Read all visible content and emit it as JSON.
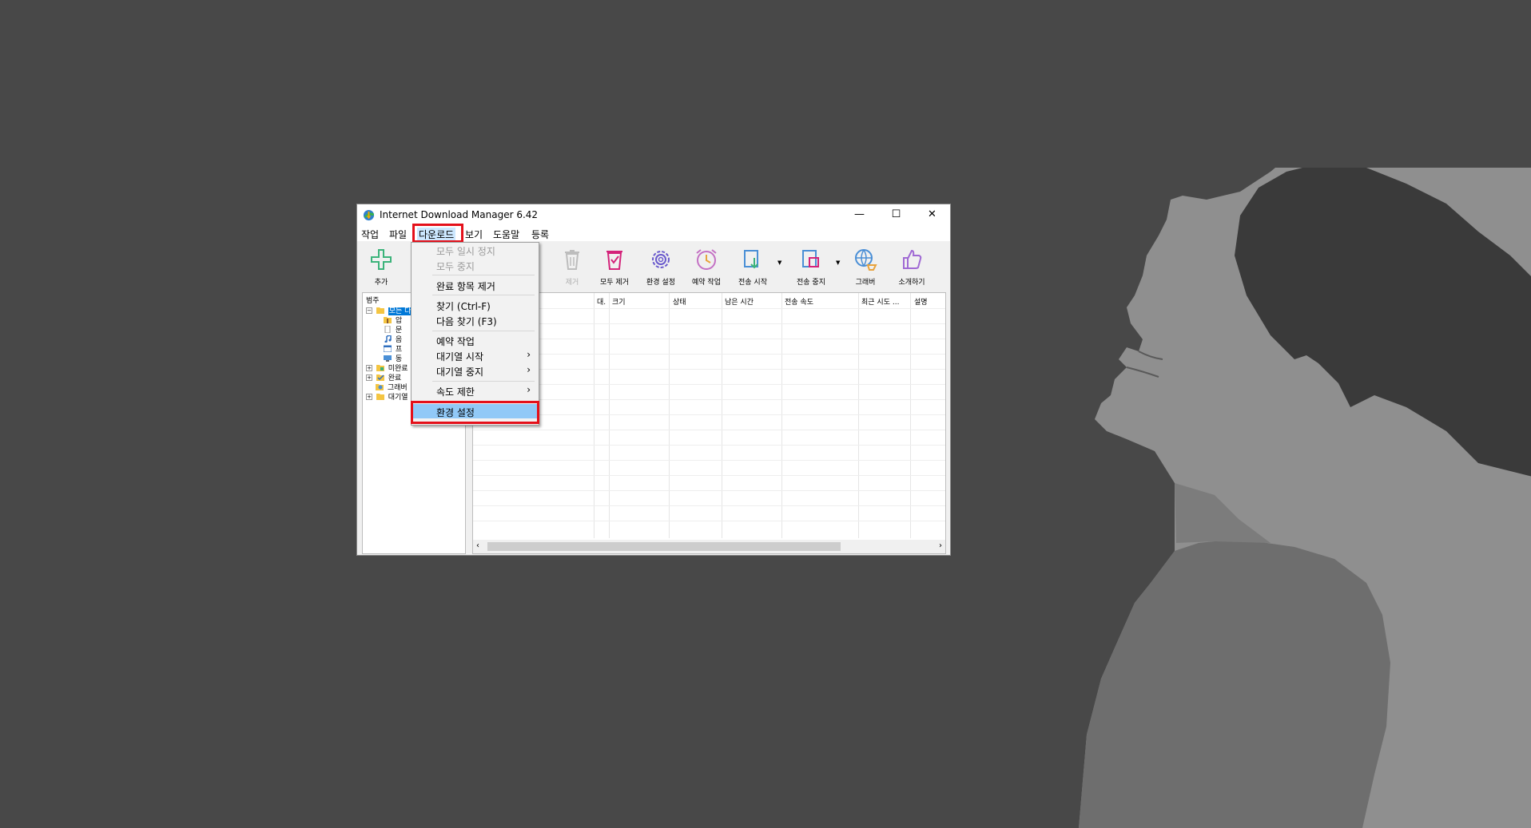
{
  "window": {
    "title": "Internet Download Manager 6.42",
    "controls": {
      "minimize": "—",
      "maximize": "☐",
      "close": "✕"
    }
  },
  "menubar": {
    "items": [
      "작업",
      "파일",
      "다운로드",
      "보기",
      "도움말",
      "등록"
    ],
    "active": "다운로드"
  },
  "toolbar": {
    "add": "추가",
    "remove": "제거",
    "remove_all": "모두 제거",
    "settings": "환경 설정",
    "scheduler": "예약 작업",
    "start_queue": "전송 시작",
    "stop_queue": "전송 중지",
    "grabber": "그래버",
    "recommend": "소개하기",
    "dropdown_arrow": "▼"
  },
  "categories": {
    "title": "범주",
    "items": [
      "모든 다",
      "압",
      "문",
      "음",
      "프",
      "동",
      "미완료",
      "완료",
      "그래버",
      "대기열"
    ],
    "expanders": {
      "minus": "−",
      "plus": "+"
    }
  },
  "columns": [
    "대.",
    "크기",
    "상태",
    "남은 시간",
    "전송 속도",
    "최근 시도 ...",
    "설명"
  ],
  "scrollbar": {
    "left": "‹",
    "right": "›"
  },
  "download_menu": {
    "items": [
      {
        "label": "모두 일시 정지",
        "disabled": true
      },
      {
        "label": "모두 중지",
        "disabled": true
      },
      {
        "label": "완료 항목 제거"
      },
      {
        "label": "찾기 (Ctrl-F)"
      },
      {
        "label": "다음 찾기 (F3)"
      },
      {
        "label": "예약 작업"
      },
      {
        "label": "대기열 시작",
        "submenu": true
      },
      {
        "label": "대기열 중지",
        "submenu": true
      },
      {
        "label": "속도 제한",
        "submenu": true
      },
      {
        "label": "환경 설정",
        "highlighted": true
      }
    ],
    "submenu_arrow": "›"
  },
  "colors": {
    "highlight_box": "#e4101a",
    "menu_highlight": "#91c9f7",
    "desktop": "#484848"
  },
  "icons": [
    "idm-app-icon",
    "add-icon",
    "trash-icon",
    "remove-all-icon",
    "gear-icon",
    "alarm-clock-icon",
    "queue-start-icon",
    "queue-stop-icon",
    "globe-grabber-icon",
    "thumbs-up-icon"
  ]
}
